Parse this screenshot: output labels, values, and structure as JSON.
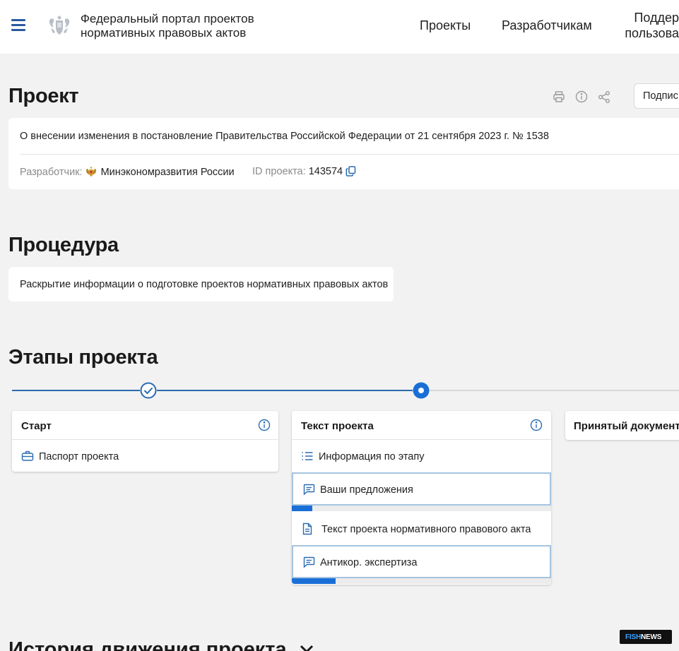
{
  "header": {
    "portal_name_line1": "Федеральный портал проектов",
    "portal_name_line2": "нормативных правовых актов",
    "nav": {
      "projects": "Проекты",
      "developers": "Разработчикам",
      "support_line1": "Поддер",
      "support_line2": "пользова"
    }
  },
  "project": {
    "heading": "Проект",
    "title": "О внесении изменения в постановление Правительства Российской Федерации от 21 сентября 2023 г. № 1538",
    "developer_label": "Разработчик:",
    "developer_value": "Минэкономразвития России",
    "id_label": "ID проекта:",
    "id_value": "143574",
    "subscribe_label": "Подпис"
  },
  "procedure": {
    "heading": "Процедура",
    "text": "Раскрытие информации о подготовке проектов нормативных правовых актов"
  },
  "stages": {
    "heading": "Этапы проекта",
    "items": [
      {
        "title": "Старт",
        "rows": [
          {
            "label": "Паспорт проекта",
            "icon": "briefcase-icon"
          }
        ]
      },
      {
        "title": "Текст проекта",
        "rows": [
          {
            "label": "Информация по этапу",
            "icon": "list-icon"
          },
          {
            "label": "Ваши предложения",
            "icon": "comment-icon",
            "progress": 0.08
          },
          {
            "label": "Текст проекта нормативного правового акта",
            "icon": "document-icon"
          },
          {
            "label": "Антикор. экспертиза",
            "icon": "comment-icon",
            "progress": 0.17
          }
        ]
      },
      {
        "title": "Принятый документ",
        "rows": []
      }
    ]
  },
  "history": {
    "heading": "История движения проекта"
  },
  "watermark": {
    "part1": "FISH",
    "part2": "NEWS"
  },
  "colors": {
    "accent": "#1a6fd6",
    "timeline": "#2a6bb0",
    "icon_blue": "#2a6bb0",
    "border_blue": "#a6c4e0",
    "background": "#f2f2f2"
  }
}
